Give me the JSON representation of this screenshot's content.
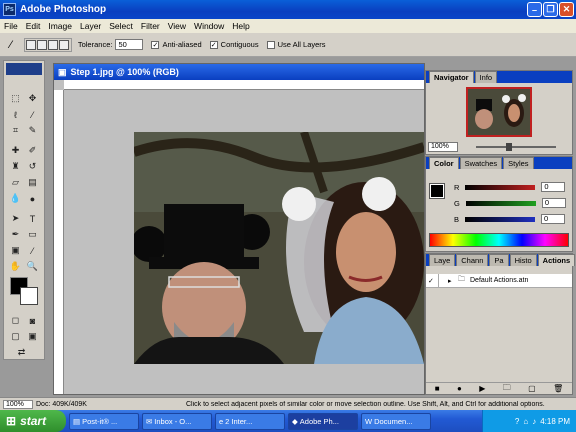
{
  "window": {
    "title": "Adobe Photoshop",
    "logo": "Ps"
  },
  "menu": [
    "File",
    "Edit",
    "Image",
    "Layer",
    "Select",
    "Filter",
    "View",
    "Window",
    "Help"
  ],
  "options": {
    "tolerance_label": "Tolerance:",
    "tolerance_value": "50",
    "anti_aliased": "Anti-aliased",
    "contiguous": "Contiguous",
    "use_all_layers": "Use All Layers"
  },
  "document": {
    "title": "Step 1.jpg @ 100% (RGB)"
  },
  "navigator": {
    "tabs": [
      "Navigator",
      "Info"
    ],
    "zoom": "100%"
  },
  "color_panel": {
    "tabs": [
      "Color",
      "Swatches",
      "Styles"
    ],
    "channels": [
      {
        "label": "R",
        "value": "0",
        "color": "#c02020"
      },
      {
        "label": "G",
        "value": "0",
        "color": "#20a020"
      },
      {
        "label": "B",
        "value": "0",
        "color": "#2030c0"
      }
    ]
  },
  "actions_panel": {
    "tabs": [
      "Laye",
      "Chann",
      "Pa",
      "Histo",
      "Actions"
    ],
    "item": "Default Actions.atn"
  },
  "status": {
    "zoom": "100%",
    "doc": "Doc: 409K/409K",
    "hint": "Click to select adjacent pixels of similar color or move selection outline.  Use Shift, Alt, and Ctrl for additional options."
  },
  "taskbar": {
    "start": "start",
    "items": [
      "Post-it® ...",
      "Inbox - O...",
      "2 Inter...",
      "Adobe Ph...",
      "Documen..."
    ],
    "time": "4:18 PM"
  },
  "colors": {
    "accent": "#0a3fc0",
    "taskbar": "#225ad4",
    "start": "#2f8e2c"
  }
}
